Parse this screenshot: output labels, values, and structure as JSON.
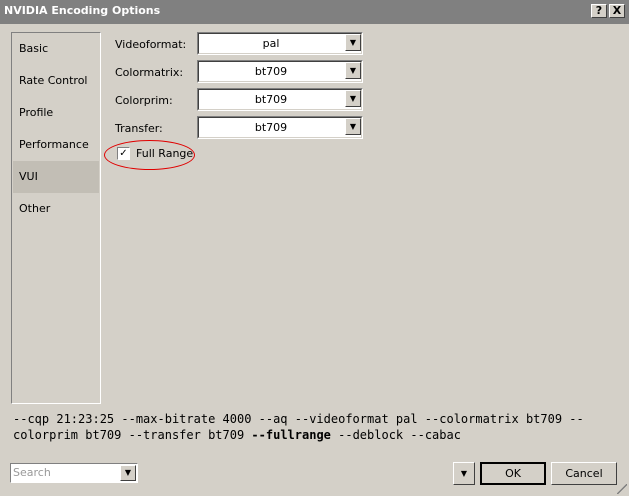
{
  "window": {
    "title": "NVIDIA Encoding Options",
    "help_glyph": "?",
    "close_glyph": "X"
  },
  "sidebar": {
    "items": [
      {
        "label": "Basic"
      },
      {
        "label": "Rate Control"
      },
      {
        "label": "Profile"
      },
      {
        "label": "Performance"
      },
      {
        "label": "VUI",
        "selected": true
      },
      {
        "label": "Other"
      }
    ]
  },
  "vui": {
    "videoformat": {
      "label": "Videoformat:",
      "value": "pal"
    },
    "colormatrix": {
      "label": "Colormatrix:",
      "value": "bt709"
    },
    "colorprim": {
      "label": "Colorprim:",
      "value": "bt709"
    },
    "transfer": {
      "label": "Transfer:",
      "value": "bt709"
    },
    "full_range": {
      "label": "Full Range",
      "checked": true,
      "check_glyph": "✓"
    }
  },
  "command_line": {
    "before": "--cqp 21:23:25 --max-bitrate 4000 --aq --videoformat pal --colormatrix bt709 --\ncolorprim bt709 --transfer bt709 ",
    "highlight": "--fullrange",
    "after": " --deblock --cabac"
  },
  "footer": {
    "search_placeholder": "Search",
    "menu_glyph": "▼",
    "ok_label": "OK",
    "cancel_label": "Cancel"
  },
  "icons": {
    "dropdown_arrow": "▼"
  },
  "colors": {
    "annotation_circle": "#e00000",
    "titlebar": "#808080",
    "face": "#d4d0c8"
  }
}
